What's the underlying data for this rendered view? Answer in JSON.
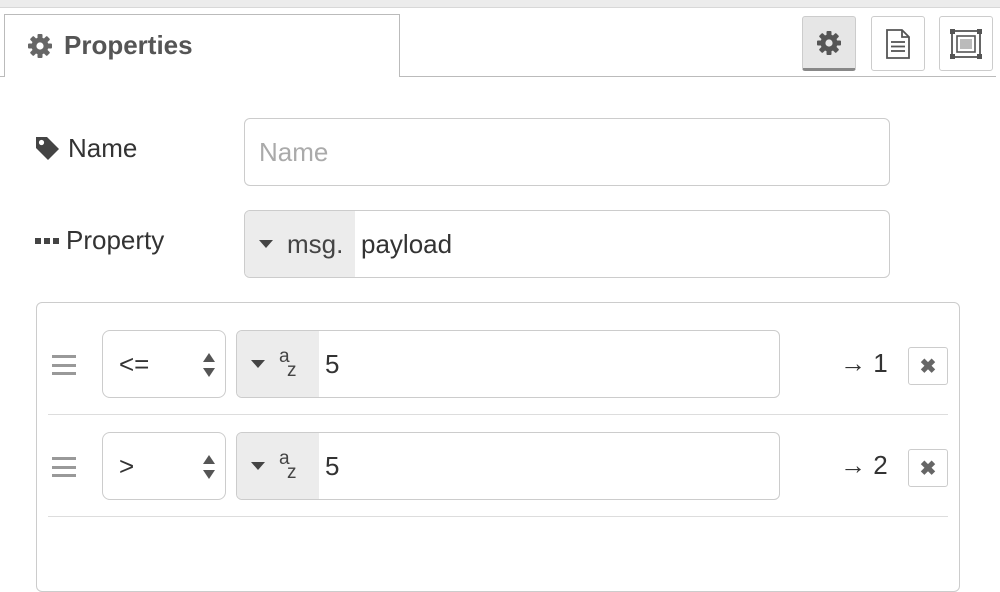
{
  "tabs": {
    "properties_label": "Properties"
  },
  "toolbar": {
    "buttons": [
      {
        "name": "settings",
        "icon": "gear-icon",
        "active": true
      },
      {
        "name": "description",
        "icon": "document-icon",
        "active": false
      },
      {
        "name": "appearance",
        "icon": "frame-icon",
        "active": false
      }
    ]
  },
  "form": {
    "name": {
      "label": "Name",
      "placeholder": "Name",
      "value": ""
    },
    "property": {
      "label": "Property",
      "type_label": "msg.",
      "value": "payload"
    }
  },
  "rules": [
    {
      "operator": "<=",
      "value_type_icon": "string-az-icon",
      "type_a": "a",
      "type_z": "z",
      "value": "5",
      "output_label": "→ 1"
    },
    {
      "operator": ">",
      "value_type_icon": "string-az-icon",
      "type_a": "a",
      "type_z": "z",
      "value": "5",
      "output_label": "→ 2"
    }
  ],
  "colors": {
    "border": "#cccccc",
    "type_button_bg": "#ececec",
    "active_tab_button_bg": "#e6e6e6"
  }
}
